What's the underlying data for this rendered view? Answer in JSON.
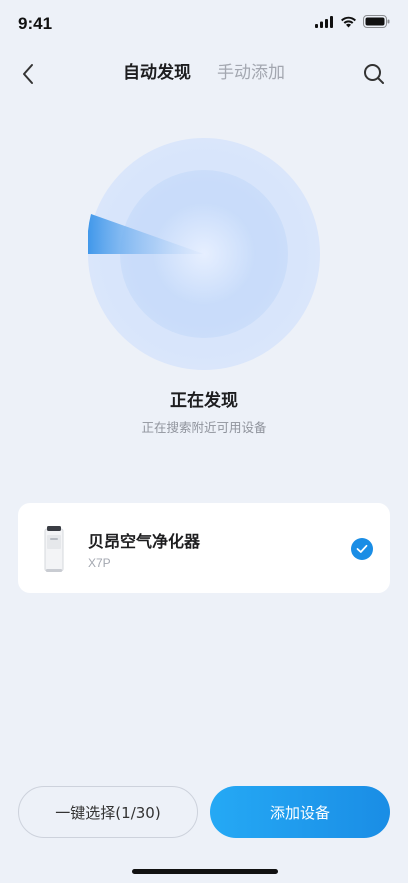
{
  "status_bar": {
    "time": "9:41"
  },
  "nav": {
    "tabs": [
      {
        "label": "自动发现",
        "active": true
      },
      {
        "label": "手动添加",
        "active": false
      }
    ]
  },
  "discovery": {
    "title": "正在发现",
    "subtitle": "正在搜索附近可用设备"
  },
  "devices": [
    {
      "name": "贝昂空气净化器",
      "model": "X7P",
      "selected": true
    }
  ],
  "actions": {
    "select_all_label": "一键选择(1/30)",
    "add_label": "添加设备"
  },
  "colors": {
    "accent": "#1a8de5",
    "background": "#edf1f8"
  },
  "icons": [
    "signal-icon",
    "wifi-icon",
    "battery-icon",
    "back-icon",
    "search-icon",
    "check-icon"
  ]
}
